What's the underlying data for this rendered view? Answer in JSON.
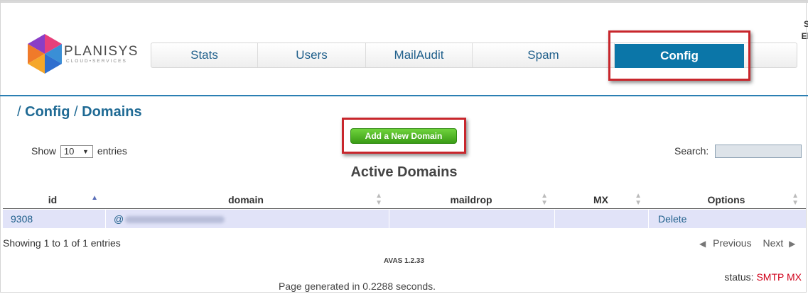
{
  "app": {
    "logo_name": "PLANISYS",
    "logo_sub": "CLOUD•SERVICES"
  },
  "nav": {
    "items": [
      {
        "label": "Stats"
      },
      {
        "label": "Users"
      },
      {
        "label": "MailAudit"
      },
      {
        "label": "Spam"
      },
      {
        "label": "Config",
        "active": true
      }
    ]
  },
  "corner": {
    "line1": "S",
    "line2": "El"
  },
  "breadcrumb": {
    "sep1": "/",
    "item1": "Config",
    "sep2": "/",
    "item2": "Domains"
  },
  "actions": {
    "add_domain": "Add a New Domain"
  },
  "length_control": {
    "prefix": "Show",
    "value": "10",
    "suffix": "entries"
  },
  "search": {
    "label": "Search:",
    "value": ""
  },
  "table": {
    "title": "Active Domains",
    "columns": [
      "id",
      "domain",
      "maildrop",
      "MX",
      "Options"
    ],
    "rows": [
      {
        "id": "9308",
        "domain_prefix": "@",
        "maildrop": "",
        "mx": "",
        "options": "Delete"
      }
    ],
    "info": "Showing 1 to 1 of 1 entries",
    "previous": "Previous",
    "next": "Next"
  },
  "footer": {
    "version": "AVAS 1.2.33",
    "status_label": "status:",
    "status_value": "SMTP MX",
    "generated": "Page generated in 0.2288 seconds."
  },
  "colors": {
    "accent": "#0b76a8",
    "highlight": "#c8262c",
    "button_green": "#4cb424",
    "row_bg": "#e1e3f8",
    "status_red": "#d0021b"
  }
}
